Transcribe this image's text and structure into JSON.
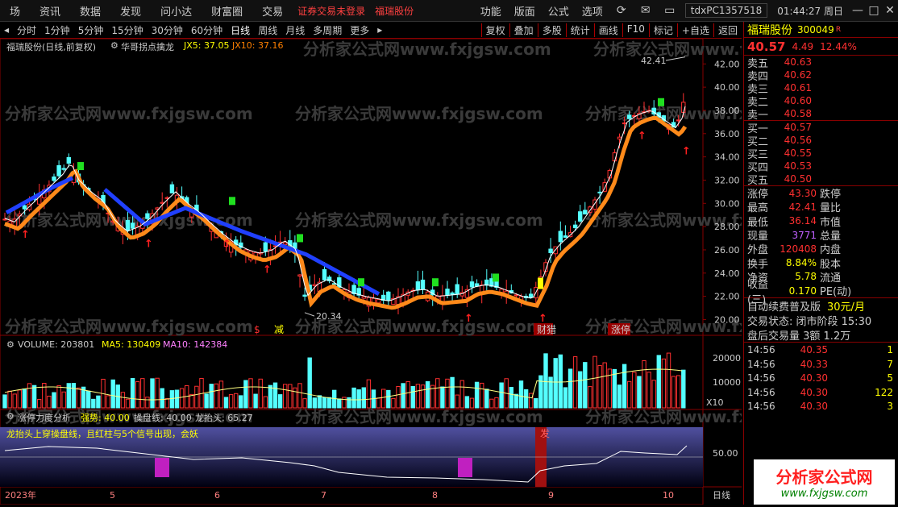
{
  "menubar": {
    "left_items": [
      "场",
      "资讯",
      "数据",
      "发现",
      "问小达",
      "财富圈",
      "交易"
    ],
    "warning": "证券交易未登录",
    "stock_name": "福瑞股份",
    "right_items": [
      "功能",
      "版面",
      "公式",
      "选项"
    ],
    "code": "tdxPC1357518",
    "time": "01:44:27 周日"
  },
  "toolbar": {
    "periods": [
      "分时",
      "1分钟",
      "5分钟",
      "15分钟",
      "30分钟",
      "60分钟",
      "日线",
      "周线",
      "月线",
      "多周期",
      "更多"
    ],
    "active_period": "日线",
    "right_buttons": [
      "复权",
      "叠加",
      "多股",
      "统计",
      "画线",
      "F10",
      "标记",
      "+自选",
      "返回"
    ]
  },
  "chart": {
    "header": "福瑞股份(日线,前复权)",
    "indicator_name": "华哥拐点擒龙",
    "jx5": "JX5: 37.05",
    "jx10": "JX10: 37.16",
    "high_label": "42.41",
    "low_label": "20.34",
    "y_ticks": [
      "42.00",
      "40.00",
      "38.00",
      "36.00",
      "34.00",
      "32.00",
      "30.00",
      "28.00",
      "26.00",
      "24.00",
      "22.00",
      "20.00"
    ],
    "markers": [
      "$",
      "减",
      "财猎",
      "涨停"
    ],
    "volume_header": "VOLUME: 203801",
    "ma5": "MA5: 130409",
    "ma10": "MA10: 142384",
    "vol_ticks": [
      "20000",
      "10000"
    ],
    "vol_unit": "X10",
    "sub_header": "涨停力度分析",
    "strength": "强势: 40.00",
    "caopan": "操盘线: 40.00",
    "longtaitou": "龙抬头: 65.27",
    "sub_note": "龙抬头上穿操盘线，且红柱与5个信号出现，会妖",
    "fa": "发",
    "sub_tick": "50.00",
    "x_labels": [
      "2023年",
      "5",
      "6",
      "7",
      "8",
      "9",
      "10"
    ],
    "day_label": "日线",
    "watermark": "分析家公式网www.fxjgsw.com"
  },
  "quote": {
    "name": "福瑞股份",
    "code": "300049",
    "r": "R",
    "price": "40.57",
    "change": "4.49",
    "pct": "12.44%",
    "asks": [
      {
        "label": "卖五",
        "price": "40.63",
        "qty": ""
      },
      {
        "label": "卖四",
        "price": "40.62",
        "qty": ""
      },
      {
        "label": "卖三",
        "price": "40.61",
        "qty": ""
      },
      {
        "label": "卖二",
        "price": "40.60",
        "qty": ""
      },
      {
        "label": "卖一",
        "price": "40.58",
        "qty": ""
      }
    ],
    "bids": [
      {
        "label": "买一",
        "price": "40.57",
        "qty": ""
      },
      {
        "label": "买二",
        "price": "40.56",
        "qty": ""
      },
      {
        "label": "买三",
        "price": "40.55",
        "qty": ""
      },
      {
        "label": "买四",
        "price": "40.53",
        "qty": ""
      },
      {
        "label": "买五",
        "price": "40.50",
        "qty": ""
      }
    ],
    "stats": [
      {
        "l": "涨停",
        "v": "43.30",
        "vc": "#ff3030",
        "l2": "跌停",
        "v2": "",
        "v2c": "#00ff00"
      },
      {
        "l": "最高",
        "v": "42.41",
        "vc": "#ff3030",
        "l2": "量比",
        "v2": "",
        "v2c": "#ffff00"
      },
      {
        "l": "最低",
        "v": "36.14",
        "vc": "#ff3030",
        "l2": "市值",
        "v2": "",
        "v2c": "#ffff00"
      },
      {
        "l": "现量",
        "v": "3771",
        "vc": "#c060ff",
        "l2": "总量",
        "v2": "",
        "v2c": "#ffff00"
      },
      {
        "l": "外盘",
        "v": "120408",
        "vc": "#ff3030",
        "l2": "内盘",
        "v2": "",
        "v2c": "#00ff00"
      },
      {
        "l": "换手",
        "v": "8.84%",
        "vc": "#ffff00",
        "l2": "股本",
        "v2": "",
        "v2c": "#ffff00"
      },
      {
        "l": "净资",
        "v": "5.78",
        "vc": "#ffff00",
        "l2": "流通",
        "v2": "",
        "v2c": "#ffff00"
      },
      {
        "l": "收益(三)",
        "v": "0.170",
        "vc": "#ffff00",
        "l2": "PE(动)",
        "v2": "",
        "v2c": "#ffff00"
      }
    ],
    "ad1": "自动续费普及版",
    "ad1_price": "30元/月",
    "trade_status": "交易状态: 闭市阶段 15:30",
    "after_vol": "盘后交易量 3额 1.2万",
    "ticks": [
      {
        "t": "14:56",
        "p": "40.35",
        "v": "1"
      },
      {
        "t": "14:56",
        "p": "40.33",
        "v": "7"
      },
      {
        "t": "14:56",
        "p": "40.30",
        "v": "5"
      },
      {
        "t": "14:56",
        "p": "40.30",
        "v": "122"
      },
      {
        "t": "14:56",
        "p": "40.30",
        "v": "3"
      }
    ],
    "logo_text": "分析家公式网",
    "logo_url": "www.fxjgsw.com"
  }
}
